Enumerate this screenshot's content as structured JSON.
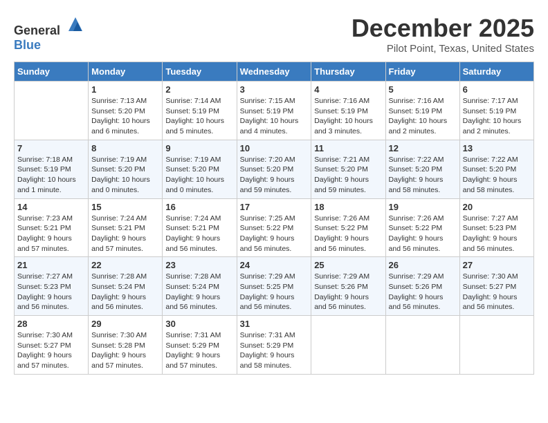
{
  "header": {
    "logo_general": "General",
    "logo_blue": "Blue",
    "title": "December 2025",
    "subtitle": "Pilot Point, Texas, United States"
  },
  "weekdays": [
    "Sunday",
    "Monday",
    "Tuesday",
    "Wednesday",
    "Thursday",
    "Friday",
    "Saturday"
  ],
  "weeks": [
    [
      {
        "day": "",
        "info": ""
      },
      {
        "day": "1",
        "info": "Sunrise: 7:13 AM\nSunset: 5:20 PM\nDaylight: 10 hours\nand 6 minutes."
      },
      {
        "day": "2",
        "info": "Sunrise: 7:14 AM\nSunset: 5:19 PM\nDaylight: 10 hours\nand 5 minutes."
      },
      {
        "day": "3",
        "info": "Sunrise: 7:15 AM\nSunset: 5:19 PM\nDaylight: 10 hours\nand 4 minutes."
      },
      {
        "day": "4",
        "info": "Sunrise: 7:16 AM\nSunset: 5:19 PM\nDaylight: 10 hours\nand 3 minutes."
      },
      {
        "day": "5",
        "info": "Sunrise: 7:16 AM\nSunset: 5:19 PM\nDaylight: 10 hours\nand 2 minutes."
      },
      {
        "day": "6",
        "info": "Sunrise: 7:17 AM\nSunset: 5:19 PM\nDaylight: 10 hours\nand 2 minutes."
      }
    ],
    [
      {
        "day": "7",
        "info": "Sunrise: 7:18 AM\nSunset: 5:19 PM\nDaylight: 10 hours\nand 1 minute."
      },
      {
        "day": "8",
        "info": "Sunrise: 7:19 AM\nSunset: 5:20 PM\nDaylight: 10 hours\nand 0 minutes."
      },
      {
        "day": "9",
        "info": "Sunrise: 7:19 AM\nSunset: 5:20 PM\nDaylight: 10 hours\nand 0 minutes."
      },
      {
        "day": "10",
        "info": "Sunrise: 7:20 AM\nSunset: 5:20 PM\nDaylight: 9 hours\nand 59 minutes."
      },
      {
        "day": "11",
        "info": "Sunrise: 7:21 AM\nSunset: 5:20 PM\nDaylight: 9 hours\nand 59 minutes."
      },
      {
        "day": "12",
        "info": "Sunrise: 7:22 AM\nSunset: 5:20 PM\nDaylight: 9 hours\nand 58 minutes."
      },
      {
        "day": "13",
        "info": "Sunrise: 7:22 AM\nSunset: 5:20 PM\nDaylight: 9 hours\nand 58 minutes."
      }
    ],
    [
      {
        "day": "14",
        "info": "Sunrise: 7:23 AM\nSunset: 5:21 PM\nDaylight: 9 hours\nand 57 minutes."
      },
      {
        "day": "15",
        "info": "Sunrise: 7:24 AM\nSunset: 5:21 PM\nDaylight: 9 hours\nand 57 minutes."
      },
      {
        "day": "16",
        "info": "Sunrise: 7:24 AM\nSunset: 5:21 PM\nDaylight: 9 hours\nand 56 minutes."
      },
      {
        "day": "17",
        "info": "Sunrise: 7:25 AM\nSunset: 5:22 PM\nDaylight: 9 hours\nand 56 minutes."
      },
      {
        "day": "18",
        "info": "Sunrise: 7:26 AM\nSunset: 5:22 PM\nDaylight: 9 hours\nand 56 minutes."
      },
      {
        "day": "19",
        "info": "Sunrise: 7:26 AM\nSunset: 5:22 PM\nDaylight: 9 hours\nand 56 minutes."
      },
      {
        "day": "20",
        "info": "Sunrise: 7:27 AM\nSunset: 5:23 PM\nDaylight: 9 hours\nand 56 minutes."
      }
    ],
    [
      {
        "day": "21",
        "info": "Sunrise: 7:27 AM\nSunset: 5:23 PM\nDaylight: 9 hours\nand 56 minutes."
      },
      {
        "day": "22",
        "info": "Sunrise: 7:28 AM\nSunset: 5:24 PM\nDaylight: 9 hours\nand 56 minutes."
      },
      {
        "day": "23",
        "info": "Sunrise: 7:28 AM\nSunset: 5:24 PM\nDaylight: 9 hours\nand 56 minutes."
      },
      {
        "day": "24",
        "info": "Sunrise: 7:29 AM\nSunset: 5:25 PM\nDaylight: 9 hours\nand 56 minutes."
      },
      {
        "day": "25",
        "info": "Sunrise: 7:29 AM\nSunset: 5:26 PM\nDaylight: 9 hours\nand 56 minutes."
      },
      {
        "day": "26",
        "info": "Sunrise: 7:29 AM\nSunset: 5:26 PM\nDaylight: 9 hours\nand 56 minutes."
      },
      {
        "day": "27",
        "info": "Sunrise: 7:30 AM\nSunset: 5:27 PM\nDaylight: 9 hours\nand 56 minutes."
      }
    ],
    [
      {
        "day": "28",
        "info": "Sunrise: 7:30 AM\nSunset: 5:27 PM\nDaylight: 9 hours\nand 57 minutes."
      },
      {
        "day": "29",
        "info": "Sunrise: 7:30 AM\nSunset: 5:28 PM\nDaylight: 9 hours\nand 57 minutes."
      },
      {
        "day": "30",
        "info": "Sunrise: 7:31 AM\nSunset: 5:29 PM\nDaylight: 9 hours\nand 57 minutes."
      },
      {
        "day": "31",
        "info": "Sunrise: 7:31 AM\nSunset: 5:29 PM\nDaylight: 9 hours\nand 58 minutes."
      },
      {
        "day": "",
        "info": ""
      },
      {
        "day": "",
        "info": ""
      },
      {
        "day": "",
        "info": ""
      }
    ]
  ]
}
